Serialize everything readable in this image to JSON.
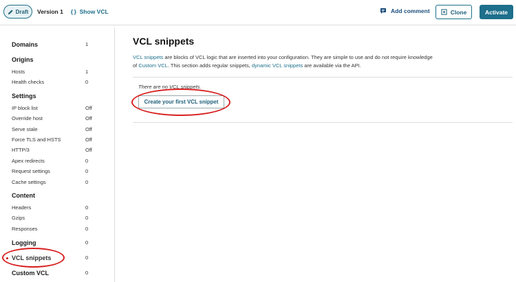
{
  "topbar": {
    "draft_label": "Draft",
    "version_label": "Version 1",
    "show_vcl_icon": "{}",
    "show_vcl_label": "Show VCL",
    "add_comment_label": "Add comment",
    "clone_label": "Clone",
    "activate_label": "Activate"
  },
  "sidebar": {
    "domains": {
      "label": "Domains",
      "value": "1"
    },
    "origins": {
      "label": "Origins"
    },
    "hosts": {
      "label": "Hosts",
      "value": "1"
    },
    "health_checks": {
      "label": "Health checks",
      "value": "0"
    },
    "settings": {
      "label": "Settings"
    },
    "ip_block_list": {
      "label": "IP block list",
      "value": "Off"
    },
    "override_host": {
      "label": "Override host",
      "value": "Off"
    },
    "serve_stale": {
      "label": "Serve stale",
      "value": "Off"
    },
    "force_tls": {
      "label": "Force TLS and HSTS",
      "value": "Off"
    },
    "http3": {
      "label": "HTTP/3",
      "value": "Off"
    },
    "apex_redirects": {
      "label": "Apex redirects",
      "value": "0"
    },
    "request_settings": {
      "label": "Request settings",
      "value": "0"
    },
    "cache_settings": {
      "label": "Cache settings",
      "value": "0"
    },
    "content": {
      "label": "Content"
    },
    "headers": {
      "label": "Headers",
      "value": "0"
    },
    "gzips": {
      "label": "Gzips",
      "value": "0"
    },
    "responses": {
      "label": "Responses",
      "value": "0"
    },
    "logging": {
      "label": "Logging",
      "value": "0"
    },
    "vcl_snippets": {
      "label": "VCL snippets",
      "value": "0"
    },
    "custom_vcl": {
      "label": "Custom VCL",
      "value": "0"
    }
  },
  "main": {
    "title": "VCL snippets",
    "desc_link1": "VCL snippets",
    "desc_text1": " are blocks of VCL logic that are inserted into your configuration. They are simple to use and do not require knowledge of ",
    "desc_link2": "Custom VCL",
    "desc_text2": ". This section adds regular snippets, ",
    "desc_link3": "dynamic VCL snippets",
    "desc_text3": " are available via the API.",
    "empty_text": "There are no VCL snippets.",
    "create_label": "Create your first VCL snippet"
  },
  "colors": {
    "accent": "#1d6f8b",
    "annotation": "#d81f1f"
  }
}
